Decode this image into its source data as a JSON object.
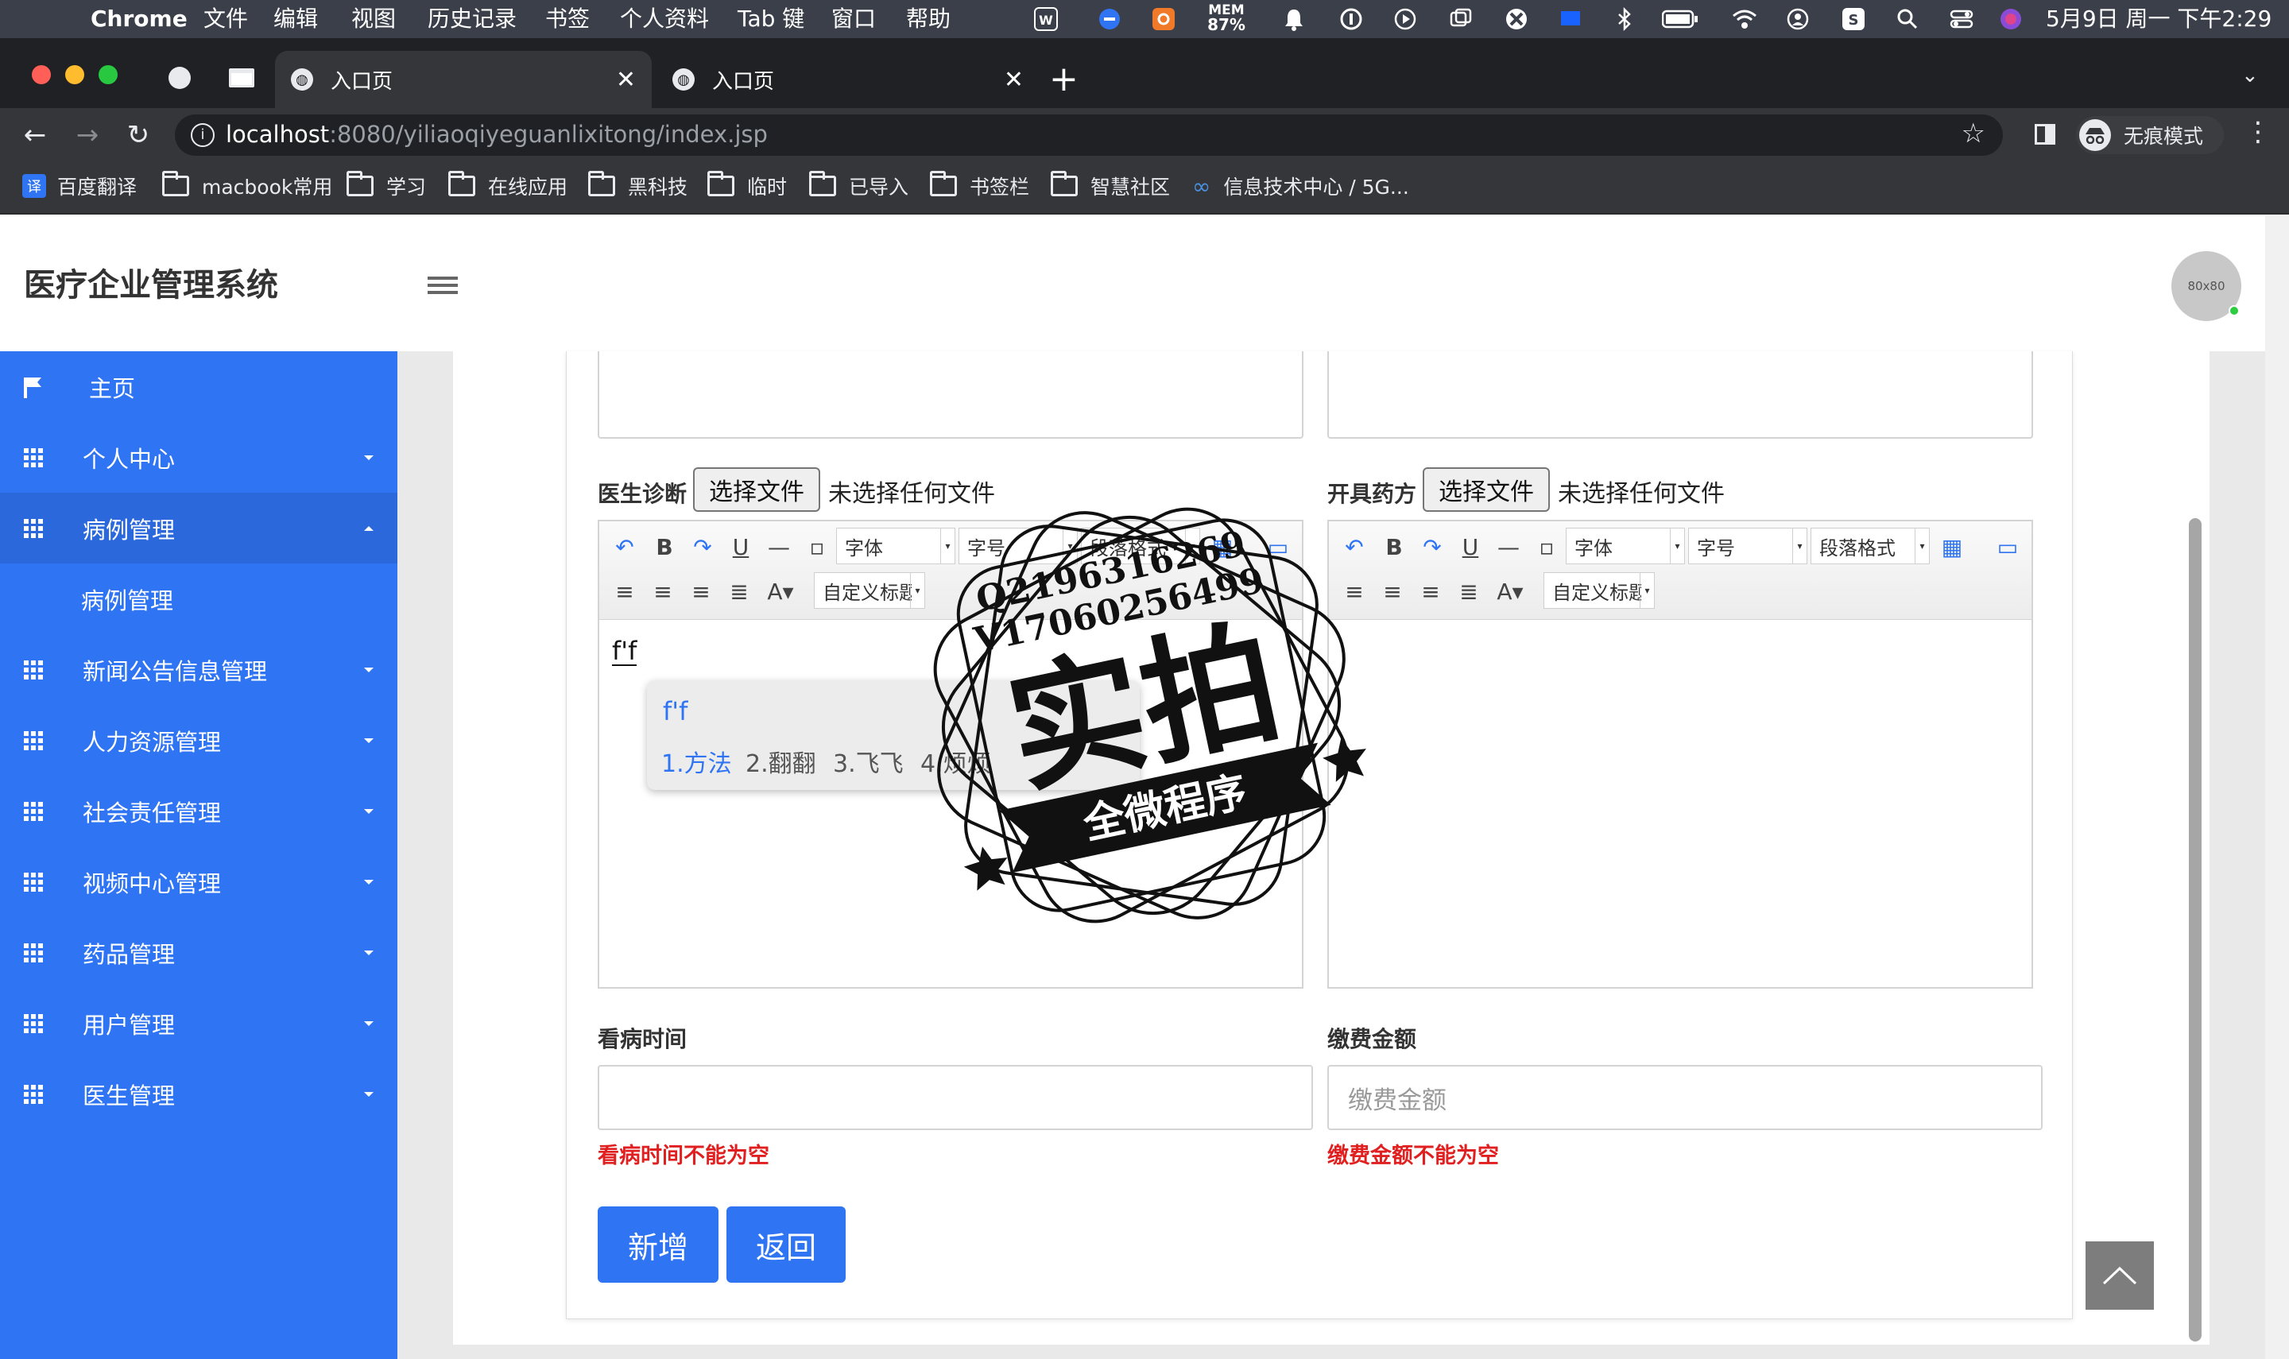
{
  "menubar": {
    "app": "Chrome",
    "items": [
      "文件",
      "编辑",
      "视图",
      "历史记录",
      "书签",
      "个人资料",
      "Tab 键",
      "窗口",
      "帮助"
    ],
    "mem_label": "MEM",
    "mem_value": "87%",
    "datetime": "5月9日 周一 下午2:29"
  },
  "tabs": [
    {
      "title": "入口页"
    },
    {
      "title": "入口页"
    }
  ],
  "address": {
    "host": "localhost",
    "path": ":8080/yiliaoqiyeguanlixitong/index.jsp"
  },
  "incognito_label": "无痕模式",
  "bookmarks": [
    "百度翻译",
    "macbook常用",
    "学习",
    "在线应用",
    "黑科技",
    "临时",
    "已导入",
    "书签栏",
    "智慧社区",
    "信息技术中心 / 5G..."
  ],
  "header": {
    "title": "医疗企业管理系统",
    "avatar_text": "80x80"
  },
  "sidebar": {
    "items": [
      {
        "label": "主页"
      },
      {
        "label": "个人中心"
      },
      {
        "label": "病例管理"
      },
      {
        "label": "病例管理"
      },
      {
        "label": "新闻公告信息管理"
      },
      {
        "label": "人力资源管理"
      },
      {
        "label": "社会责任管理"
      },
      {
        "label": "视频中心管理"
      },
      {
        "label": "药品管理"
      },
      {
        "label": "用户管理"
      },
      {
        "label": "医生管理"
      }
    ]
  },
  "form": {
    "diagnosis_label": "医生诊断",
    "prescription_label": "开具药方",
    "choose_file": "选择文件",
    "no_file": "未选择任何文件",
    "editor": {
      "font": "字体",
      "size": "字号",
      "paragraph": "段落格式",
      "custom_title": "自定义标题"
    },
    "diagnosis_text": "f'f",
    "visit_time_label": "看病时间",
    "visit_time_error": "看病时间不能为空",
    "fee_label": "缴费金额",
    "fee_placeholder": "缴费金额",
    "fee_error": "缴费金额不能为空",
    "add_button": "新增",
    "back_button": "返回"
  },
  "ime": {
    "input": "f'f",
    "candidates": [
      "1.方法",
      "2.翻翻",
      "3.飞飞",
      "4.烦烦"
    ]
  },
  "watermark": {
    "line1": "Q2196316269",
    "line2": "V17060256499",
    "big": "实拍",
    "banner": "全微程序"
  }
}
